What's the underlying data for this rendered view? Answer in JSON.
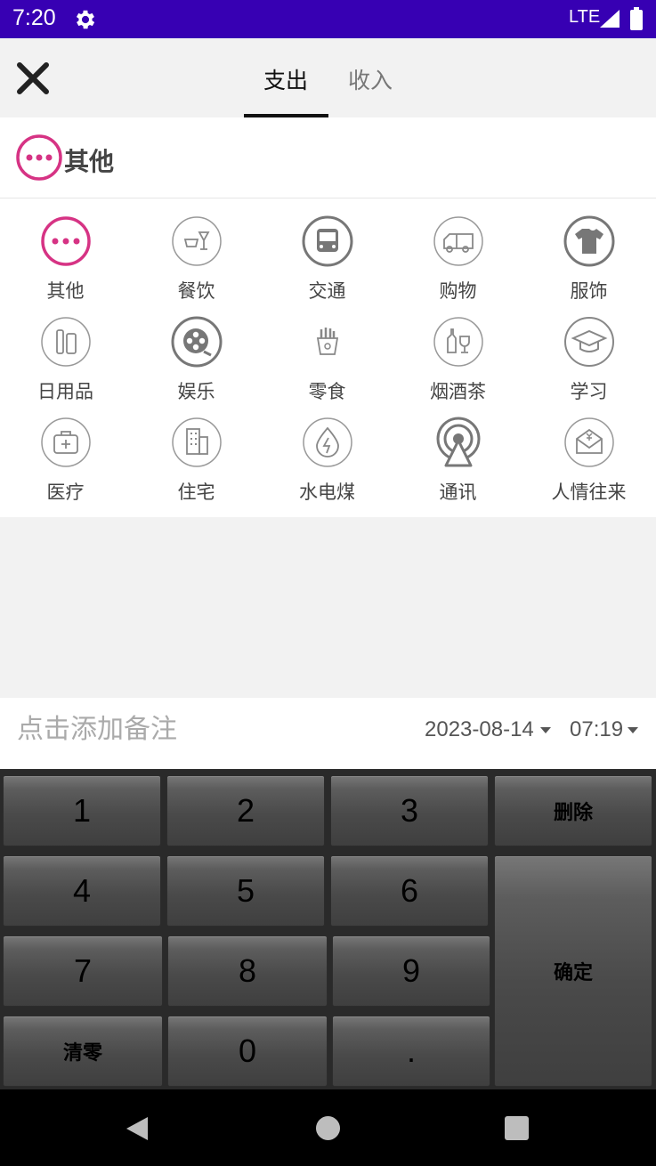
{
  "status_bar": {
    "time": "7:20",
    "network": "LTE",
    "icons": [
      "settings-icon",
      "signal-icon",
      "battery-icon"
    ]
  },
  "header": {
    "tabs": [
      {
        "label": "支出",
        "selected": true
      },
      {
        "label": "收入",
        "selected": false
      }
    ],
    "close_icon": "close-icon"
  },
  "selected_category": {
    "label": "其他",
    "icon": "more-icon",
    "accent": "#d63384"
  },
  "categories": [
    {
      "label": "其他",
      "icon": "more-icon"
    },
    {
      "label": "餐饮",
      "icon": "dining-icon"
    },
    {
      "label": "交通",
      "icon": "bus-icon"
    },
    {
      "label": "购物",
      "icon": "truck-icon"
    },
    {
      "label": "服饰",
      "icon": "shirt-icon"
    },
    {
      "label": "日用品",
      "icon": "toiletries-icon"
    },
    {
      "label": "娱乐",
      "icon": "film-reel-icon"
    },
    {
      "label": "零食",
      "icon": "fries-icon"
    },
    {
      "label": "烟酒茶",
      "icon": "bottle-glass-icon"
    },
    {
      "label": "学习",
      "icon": "graduation-cap-icon"
    },
    {
      "label": "医疗",
      "icon": "medical-kit-icon"
    },
    {
      "label": "住宅",
      "icon": "building-icon"
    },
    {
      "label": "水电煤",
      "icon": "utilities-icon"
    },
    {
      "label": "通讯",
      "icon": "antenna-icon"
    },
    {
      "label": "人情往来",
      "icon": "red-envelope-icon"
    }
  ],
  "note": {
    "placeholder": "点击添加备注",
    "date": "2023-08-14",
    "time": "07:19"
  },
  "keypad": {
    "k1": "1",
    "k2": "2",
    "k3": "3",
    "delete": "删除",
    "k4": "4",
    "k5": "5",
    "k6": "6",
    "k7": "7",
    "k8": "8",
    "k9": "9",
    "confirm": "确定",
    "clear": "清零",
    "k0": "0",
    "dot": "."
  },
  "colors": {
    "status_bar": "#3700b3",
    "accent": "#d63384",
    "icon_gray": "#888888",
    "keypad_bg": "#2a2a2a"
  }
}
